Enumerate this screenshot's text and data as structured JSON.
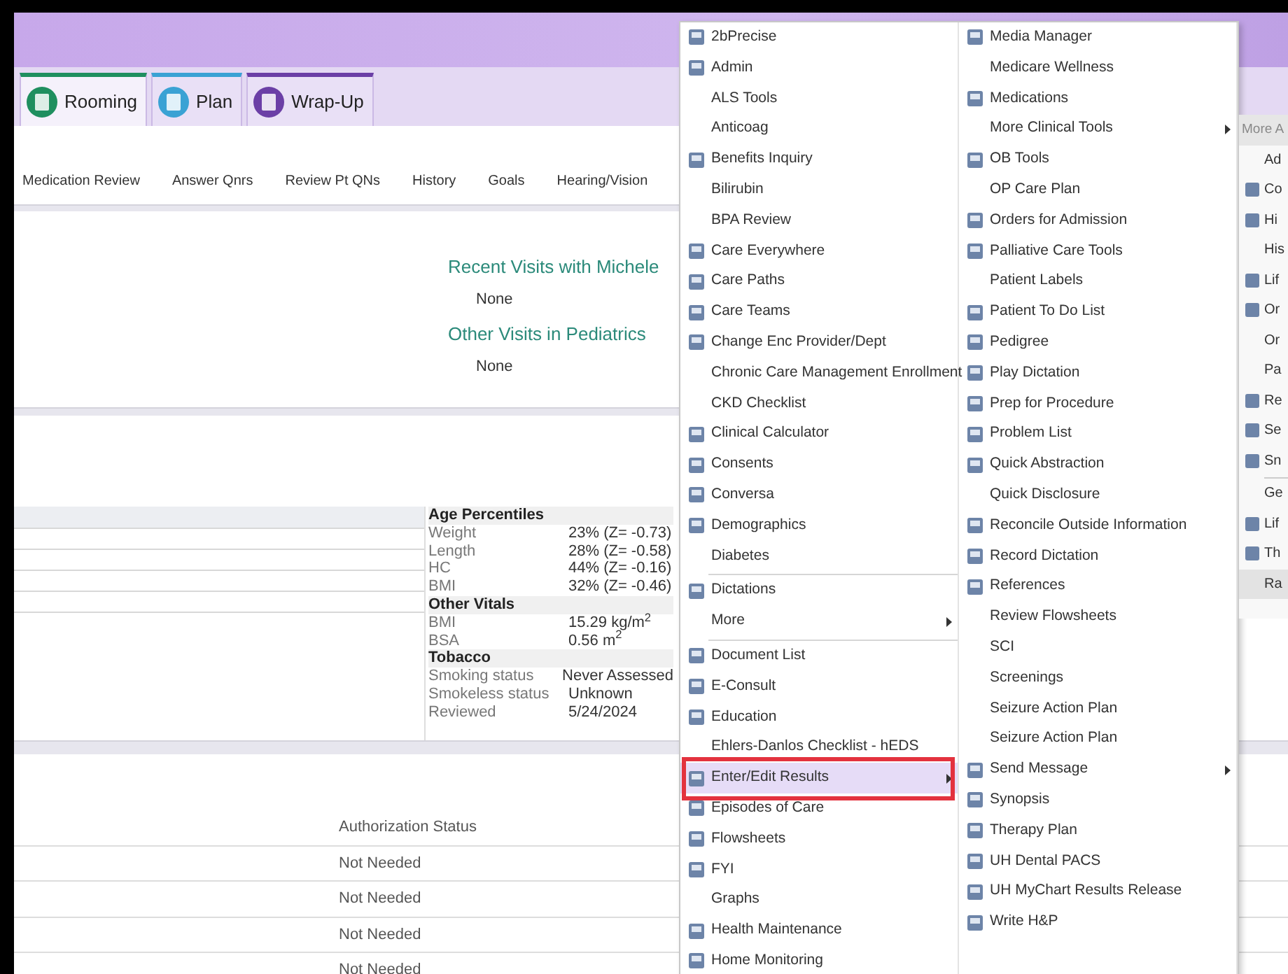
{
  "header": {
    "tabs": [
      {
        "label": "Rooming",
        "selected": true,
        "color": "#1f8f5f"
      },
      {
        "label": "Plan",
        "selected": false,
        "color": "#3aa2d4"
      },
      {
        "label": "Wrap-Up",
        "selected": false,
        "color": "#6b3fa6"
      }
    ]
  },
  "activity_links": [
    "Medication Review",
    "Answer Qnrs",
    "Review Pt QNs",
    "History",
    "Goals",
    "Hearing/Vision"
  ],
  "visits": [
    {
      "title": "Recent Visits with Michele",
      "value": "None"
    },
    {
      "title": "Other Visits in Pediatrics",
      "value": "None"
    }
  ],
  "vitals": [
    {
      "heading": "Age Percentiles",
      "rows": [
        {
          "label": "Weight",
          "value": "23% (Z= -0.73)"
        },
        {
          "label": "Length",
          "value": "28% (Z= -0.58)"
        },
        {
          "label": "HC",
          "value": "44% (Z= -0.16)"
        },
        {
          "label": "BMI",
          "value": "32% (Z= -0.46)"
        }
      ]
    },
    {
      "heading": "Other Vitals",
      "rows": [
        {
          "label": "BMI",
          "value": "15.29 kg/m$^{2}$"
        },
        {
          "label": "BSA",
          "value": "0.56 m$^{2}$"
        }
      ]
    },
    {
      "heading": "Tobacco",
      "rows": [
        {
          "label": "Smoking status",
          "value": "Never Assessed"
        },
        {
          "label": "Smokeless status",
          "value": "Unknown"
        },
        {
          "label": "Reviewed",
          "value": "5/24/2024"
        }
      ]
    }
  ],
  "orders_table": {
    "columns": [
      "Authorization Status"
    ],
    "rows": [
      [
        "Not Needed"
      ],
      [
        "Not Needed"
      ],
      [
        "Not Needed"
      ],
      [
        "Not Needed"
      ]
    ]
  },
  "menu": {
    "frame_selected": true,
    "columns": [
      [
        {
          "kind": "item",
          "label": "2bPrecise",
          "icon": true,
          "submenu": false,
          "selected": false
        },
        {
          "kind": "item",
          "label": "Admin",
          "icon": true,
          "submenu": false,
          "selected": false
        },
        {
          "kind": "item",
          "label": "ALS Tools",
          "icon": false,
          "submenu": false,
          "selected": false
        },
        {
          "kind": "item",
          "label": "Anticoag",
          "icon": false,
          "submenu": false,
          "selected": false
        },
        {
          "kind": "item",
          "label": "Benefits Inquiry",
          "icon": true,
          "submenu": false,
          "selected": false
        },
        {
          "kind": "item",
          "label": "Bilirubin",
          "icon": false,
          "submenu": false,
          "selected": false
        },
        {
          "kind": "item",
          "label": "BPA Review",
          "icon": false,
          "submenu": false,
          "selected": false
        },
        {
          "kind": "item",
          "label": "Care Everywhere",
          "icon": true,
          "submenu": false,
          "selected": false
        },
        {
          "kind": "item",
          "label": "Care Paths",
          "icon": true,
          "submenu": false,
          "selected": false
        },
        {
          "kind": "item",
          "label": "Care Teams",
          "icon": true,
          "submenu": false,
          "selected": false
        },
        {
          "kind": "item",
          "label": "Change Enc Provider/Dept",
          "icon": true,
          "submenu": false,
          "selected": false
        },
        {
          "kind": "item",
          "label": "Chronic Care Management Enrollment",
          "icon": false,
          "submenu": false,
          "selected": false
        },
        {
          "kind": "item",
          "label": "CKD Checklist",
          "icon": false,
          "submenu": false,
          "selected": false
        },
        {
          "kind": "item",
          "label": "Clinical Calculator",
          "icon": true,
          "submenu": false,
          "selected": false
        },
        {
          "kind": "item",
          "label": "Consents",
          "icon": true,
          "submenu": false,
          "selected": false
        },
        {
          "kind": "item",
          "label": "Conversa",
          "icon": true,
          "submenu": false,
          "selected": false
        },
        {
          "kind": "item",
          "label": "Demographics",
          "icon": true,
          "submenu": false,
          "selected": false
        },
        {
          "kind": "item",
          "label": "Diabetes",
          "icon": false,
          "submenu": false,
          "selected": false
        },
        {
          "kind": "separator"
        },
        {
          "kind": "item",
          "label": "Dictations",
          "icon": true,
          "submenu": false,
          "selected": false
        },
        {
          "kind": "item",
          "label": "More",
          "icon": false,
          "submenu": true,
          "selected": false
        },
        {
          "kind": "separator"
        },
        {
          "kind": "item",
          "label": "Document List",
          "icon": true,
          "submenu": false,
          "selected": false
        },
        {
          "kind": "item",
          "label": "E-Consult",
          "icon": true,
          "submenu": false,
          "selected": false
        },
        {
          "kind": "item",
          "label": "Education",
          "icon": true,
          "submenu": false,
          "selected": false
        },
        {
          "kind": "item",
          "label": "Ehlers-Danlos Checklist - hEDS",
          "icon": false,
          "submenu": false,
          "selected": false
        },
        {
          "kind": "item",
          "label": "Enter/Edit Results",
          "icon": true,
          "submenu": true,
          "selected": true
        },
        {
          "kind": "item",
          "label": "Episodes of Care",
          "icon": true,
          "submenu": false,
          "selected": false
        },
        {
          "kind": "item",
          "label": "Flowsheets",
          "icon": true,
          "submenu": false,
          "selected": false
        },
        {
          "kind": "item",
          "label": "FYI",
          "icon": true,
          "submenu": false,
          "selected": false
        },
        {
          "kind": "item",
          "label": "Graphs",
          "icon": false,
          "submenu": false,
          "selected": false
        },
        {
          "kind": "item",
          "label": "Health Maintenance",
          "icon": true,
          "submenu": false,
          "selected": false
        },
        {
          "kind": "item",
          "label": "Home Monitoring",
          "icon": true,
          "submenu": false,
          "selected": false
        }
      ],
      [
        {
          "kind": "item",
          "label": "Media Manager",
          "icon": true,
          "submenu": false,
          "selected": false
        },
        {
          "kind": "item",
          "label": "Medicare Wellness",
          "icon": false,
          "submenu": false,
          "selected": false
        },
        {
          "kind": "item",
          "label": "Medications",
          "icon": true,
          "submenu": false,
          "selected": false
        },
        {
          "kind": "item",
          "label": "More Clinical Tools",
          "icon": false,
          "submenu": true,
          "selected": false
        },
        {
          "kind": "item",
          "label": "OB Tools",
          "icon": true,
          "submenu": false,
          "selected": false
        },
        {
          "kind": "item",
          "label": "OP Care Plan",
          "icon": false,
          "submenu": false,
          "selected": false
        },
        {
          "kind": "item",
          "label": "Orders for Admission",
          "icon": true,
          "submenu": false,
          "selected": false
        },
        {
          "kind": "item",
          "label": "Palliative Care Tools",
          "icon": true,
          "submenu": false,
          "selected": false
        },
        {
          "kind": "item",
          "label": "Patient Labels",
          "icon": false,
          "submenu": false,
          "selected": false
        },
        {
          "kind": "item",
          "label": "Patient To Do List",
          "icon": true,
          "submenu": false,
          "selected": false
        },
        {
          "kind": "item",
          "label": "Pedigree",
          "icon": true,
          "submenu": false,
          "selected": false
        },
        {
          "kind": "item",
          "label": "Play Dictation",
          "icon": true,
          "submenu": false,
          "selected": false
        },
        {
          "kind": "item",
          "label": "Prep for Procedure",
          "icon": true,
          "submenu": false,
          "selected": false
        },
        {
          "kind": "item",
          "label": "Problem List",
          "icon": true,
          "submenu": false,
          "selected": false
        },
        {
          "kind": "item",
          "label": "Quick Abstraction",
          "icon": true,
          "submenu": false,
          "selected": false
        },
        {
          "kind": "item",
          "label": "Quick Disclosure",
          "icon": false,
          "submenu": false,
          "selected": false
        },
        {
          "kind": "item",
          "label": "Reconcile Outside Information",
          "icon": true,
          "submenu": false,
          "selected": false
        },
        {
          "kind": "item",
          "label": "Record Dictation",
          "icon": true,
          "submenu": false,
          "selected": false
        },
        {
          "kind": "item",
          "label": "References",
          "icon": true,
          "submenu": false,
          "selected": false
        },
        {
          "kind": "item",
          "label": "Review Flowsheets",
          "icon": false,
          "submenu": false,
          "selected": false
        },
        {
          "kind": "item",
          "label": "SCI",
          "icon": false,
          "submenu": false,
          "selected": false
        },
        {
          "kind": "item",
          "label": "Screenings",
          "icon": false,
          "submenu": false,
          "selected": false
        },
        {
          "kind": "item",
          "label": "Seizure Action Plan",
          "icon": false,
          "submenu": false,
          "selected": false
        },
        {
          "kind": "item",
          "label": "Seizure Action Plan",
          "icon": false,
          "submenu": false,
          "selected": false
        },
        {
          "kind": "item",
          "label": "Send Message",
          "icon": true,
          "submenu": true,
          "selected": false
        },
        {
          "kind": "item",
          "label": "Synopsis",
          "icon": true,
          "submenu": false,
          "selected": false
        },
        {
          "kind": "item",
          "label": "Therapy Plan",
          "icon": true,
          "submenu": false,
          "selected": false
        },
        {
          "kind": "item",
          "label": "UH Dental PACS",
          "icon": true,
          "submenu": false,
          "selected": false
        },
        {
          "kind": "item",
          "label": "UH MyChart Results Release",
          "icon": true,
          "submenu": false,
          "selected": false
        },
        {
          "kind": "item",
          "label": "Write H&P",
          "icon": true,
          "submenu": false,
          "selected": false
        }
      ]
    ]
  },
  "submenu": {
    "items": [
      {
        "kind": "header",
        "label": "More A"
      },
      {
        "kind": "item",
        "label": "Ad",
        "icon": false,
        "selected": false
      },
      {
        "kind": "item",
        "label": "Co",
        "icon": true,
        "selected": false
      },
      {
        "kind": "item",
        "label": "Hi",
        "icon": true,
        "selected": false
      },
      {
        "kind": "item",
        "label": "His",
        "icon": false,
        "selected": false
      },
      {
        "kind": "item",
        "label": "Lif",
        "icon": true,
        "selected": false
      },
      {
        "kind": "item",
        "label": "Or",
        "icon": true,
        "selected": false
      },
      {
        "kind": "item",
        "label": "Or",
        "icon": false,
        "selected": false
      },
      {
        "kind": "item",
        "label": "Pa",
        "icon": false,
        "selected": false
      },
      {
        "kind": "item",
        "label": "Re",
        "icon": true,
        "selected": false
      },
      {
        "kind": "item",
        "label": "Se",
        "icon": true,
        "selected": false
      },
      {
        "kind": "item",
        "label": "Sn",
        "icon": true,
        "selected": false
      },
      {
        "kind": "separator"
      },
      {
        "kind": "item",
        "label": "Ge",
        "icon": false,
        "selected": false
      },
      {
        "kind": "item",
        "label": "Lif",
        "icon": true,
        "selected": false
      },
      {
        "kind": "item",
        "label": "Th",
        "icon": true,
        "selected": false
      },
      {
        "kind": "item",
        "label": "Ra",
        "icon": false,
        "selected": true
      }
    ]
  }
}
